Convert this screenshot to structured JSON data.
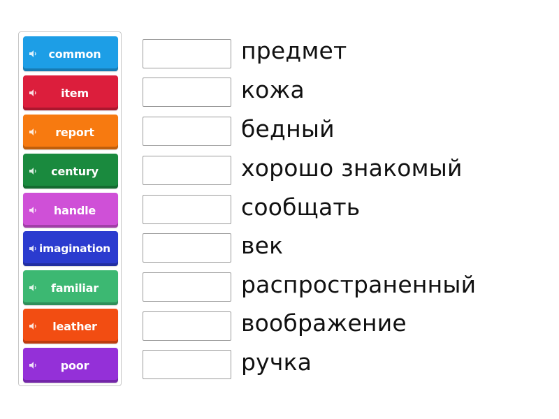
{
  "tiles": [
    {
      "label": "common",
      "color": "#1d9ee6"
    },
    {
      "label": "item",
      "color": "#dc1e3c"
    },
    {
      "label": "report",
      "color": "#f77a10"
    },
    {
      "label": "century",
      "color": "#1a8a3e"
    },
    {
      "label": "handle",
      "color": "#cf50d7"
    },
    {
      "label": "imagination",
      "color": "#2b3bcf"
    },
    {
      "label": "familiar",
      "color": "#3cb872"
    },
    {
      "label": "leather",
      "color": "#f24d12"
    },
    {
      "label": "poor",
      "color": "#9430d8"
    }
  ],
  "definitions": [
    "предмет",
    "кожа",
    "бедный",
    "хорошо знакомый",
    "сообщать",
    "век",
    "распространенный",
    "воображение",
    "ручка"
  ],
  "icons": {
    "tile_audio": "speaker-icon"
  }
}
